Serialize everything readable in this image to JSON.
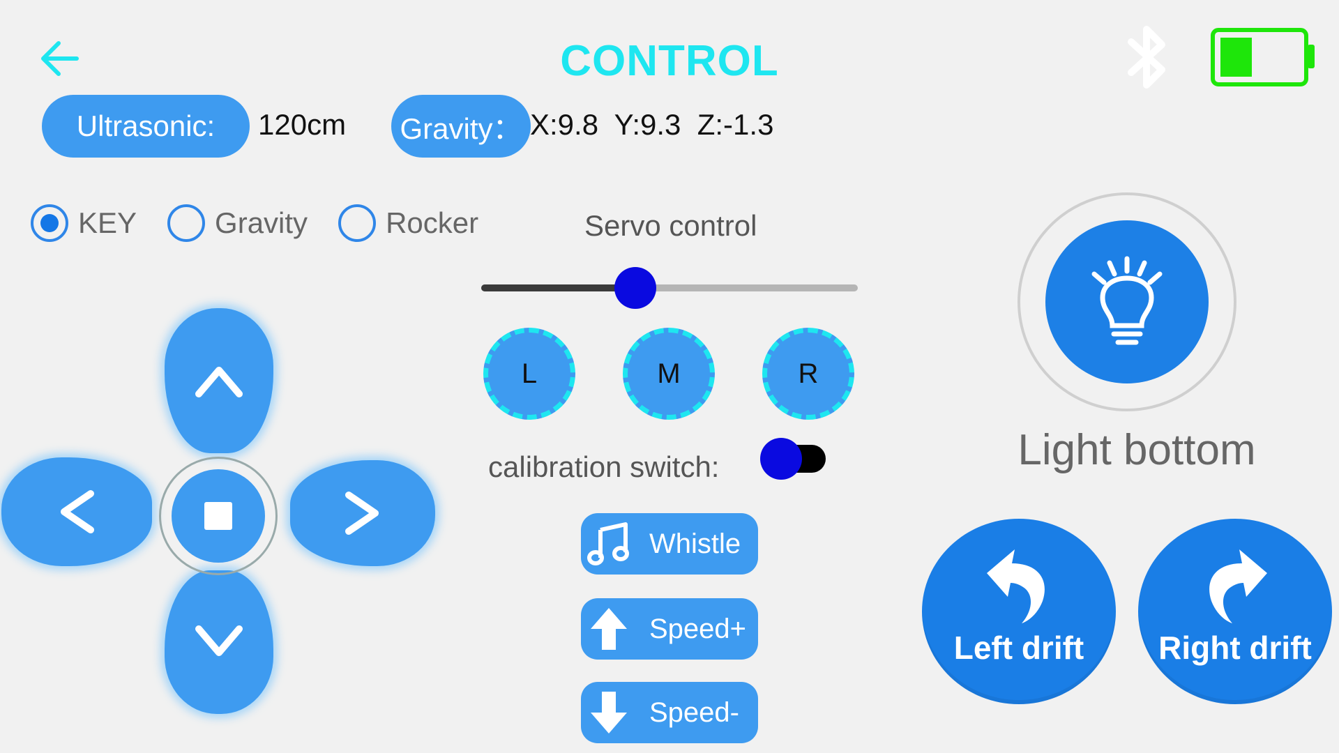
{
  "header": {
    "title": "CONTROL",
    "back_icon": "arrow-left-icon",
    "bluetooth_icon": "bluetooth-icon",
    "battery_icon": "battery-icon",
    "battery_level": 0.4,
    "title_color": "#1ee6f0",
    "battery_color": "#1ee60a"
  },
  "sensors": {
    "ultrasonic_label": "Ultrasonic:",
    "ultrasonic_value": "120cm",
    "gravity_label": "Gravity：",
    "gravity_value": "X:9.8  Y:9.3  Z:-1.3"
  },
  "mode": {
    "options": [
      "KEY",
      "Gravity",
      "Rocker"
    ],
    "selected": "KEY"
  },
  "servo": {
    "label": "Servo control",
    "slider_value": 0.41,
    "buttons": [
      "L",
      "M",
      "R"
    ]
  },
  "calibration": {
    "label": "calibration switch:",
    "on": false
  },
  "functions": {
    "whistle": "Whistle",
    "speed_up": "Speed+",
    "speed_down": "Speed-"
  },
  "dpad": {
    "up_icon": "chevron-up-icon",
    "down_icon": "chevron-down-icon",
    "left_icon": "chevron-left-icon",
    "right_icon": "chevron-right-icon",
    "stop_icon": "stop-icon"
  },
  "light": {
    "label": "Light bottom",
    "icon": "lightbulb-icon"
  },
  "drift": {
    "left_label": "Left drift",
    "right_label": "Right drift"
  },
  "colors": {
    "accent_blue": "#3e9bf0",
    "deep_blue": "#1a7ee6",
    "thumb_blue": "#0a0ae0"
  }
}
